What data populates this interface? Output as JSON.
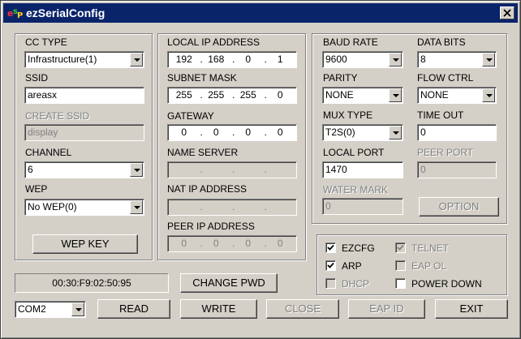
{
  "window": {
    "title": "ezSerialConfig",
    "app_icon": "ez-serial-icon",
    "close_icon": "close-icon"
  },
  "left": {
    "cc_type_label": "CC TYPE",
    "cc_type_value": "Infrastructure(1)",
    "ssid_label": "SSID",
    "ssid_value": "areasx",
    "create_ssid_label": "CREATE SSID",
    "create_ssid_value": "display",
    "channel_label": "CHANNEL",
    "channel_value": "6",
    "wep_label": "WEP",
    "wep_value": "No WEP(0)",
    "wep_key_button": "WEP KEY"
  },
  "mid": {
    "local_ip_label": "LOCAL IP ADDRESS",
    "local_ip": [
      "192",
      "168",
      "0",
      "1"
    ],
    "subnet_label": "SUBNET MASK",
    "subnet": [
      "255",
      "255",
      "255",
      "0"
    ],
    "gateway_label": "GATEWAY",
    "gateway": [
      "0",
      "0",
      "0",
      "0"
    ],
    "name_server_label": "NAME SERVER",
    "nat_ip_label": "NAT IP ADDRESS",
    "peer_ip_label": "PEER IP ADDRESS",
    "peer_ip": [
      "0",
      "0",
      "0",
      "0"
    ],
    "dot": "."
  },
  "right": {
    "baud_label": "BAUD RATE",
    "baud_value": "9600",
    "data_bits_label": "DATA BITS",
    "data_bits_value": "8",
    "parity_label": "PARITY",
    "parity_value": "NONE",
    "flow_label": "FLOW CTRL",
    "flow_value": "NONE",
    "mux_label": "MUX TYPE",
    "mux_value": "T2S(0)",
    "timeout_label": "TIME OUT",
    "timeout_value": "0",
    "local_port_label": "LOCAL PORT",
    "local_port_value": "1470",
    "peer_port_label": "PEER PORT",
    "peer_port_value": "0",
    "water_mark_label": "WATER MARK",
    "water_mark_value": "0",
    "option_button": "OPTION"
  },
  "checks": {
    "ezcfg": {
      "label": "EZCFG",
      "checked": true
    },
    "telnet": {
      "label": "TELNET",
      "checked": true
    },
    "arp": {
      "label": "ARP",
      "checked": true
    },
    "eap_ol": {
      "label": "EAP OL",
      "checked": false
    },
    "dhcp": {
      "label": "DHCP",
      "checked": false
    },
    "power_down": {
      "label": "POWER DOWN",
      "checked": false
    }
  },
  "bottom": {
    "mac": "00:30:F9:02:50:95",
    "change_pwd": "CHANGE PWD",
    "port_value": "COM2",
    "read": "READ",
    "write": "WRITE",
    "close": "CLOSE",
    "eap_id": "EAP ID",
    "exit": "EXIT"
  },
  "colors": {
    "titlebar": "#0a246a",
    "face": "#d4d0c8",
    "disabled_text": "#808080"
  }
}
